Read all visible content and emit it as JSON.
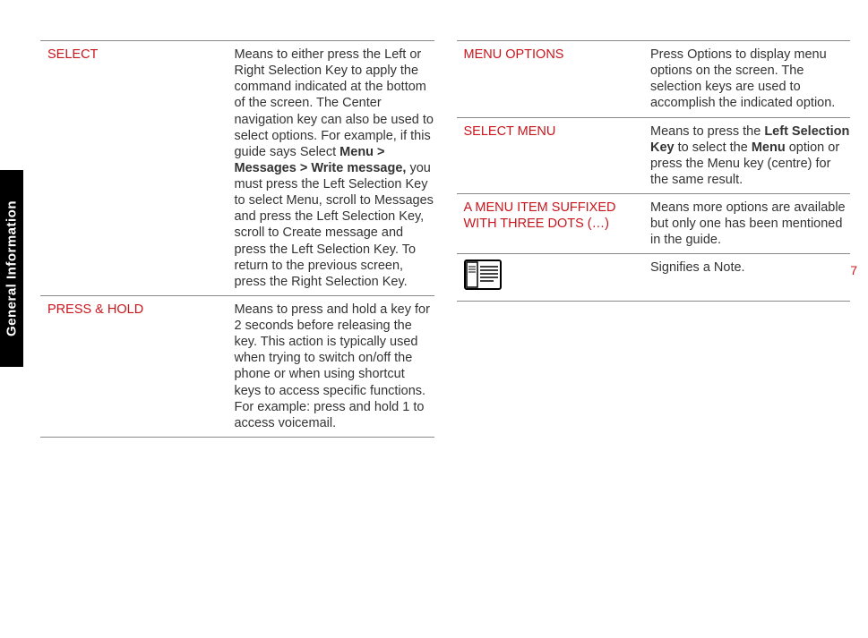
{
  "sideTab": {
    "label": "General Information"
  },
  "pageNumber": "7",
  "left": {
    "rows": [
      {
        "term": "SELECT",
        "desc_pre": "Means to either press the Left or Right Selection Key to apply the command indicated at the bottom of the screen. The Center navigation key can also be used to select options. For example, if this guide says Select ",
        "desc_bold": "Menu > Messages > Write message,",
        "desc_post": " you must press the Left Selection Key to select Menu, scroll to Messages and press the Left Selection Key, scroll to Create message and press the Left Selection Key. To return to the previous screen, press the Right Selection Key."
      },
      {
        "term": "PRESS & HOLD",
        "desc": "Means to press and hold a key for 2 seconds before releasing the key. This action is typically used when trying to switch on/off the phone or when using shortcut keys to access specific functions. For example: press and hold 1 to access voicemail."
      }
    ]
  },
  "right": {
    "rows": [
      {
        "term": "MENU OPTIONS",
        "desc": "Press Options to display menu options on the screen. The selection keys are used to accomplish the indicated option."
      },
      {
        "term": "SELECT MENU",
        "desc_pre": "Means to press the ",
        "desc_bold1": "Left Selection Key",
        "desc_mid": " to select the ",
        "desc_bold2": "Menu",
        "desc_post": " option or press the Menu key (centre) for the same result."
      },
      {
        "term": "A MENU ITEM SUFFIXED WITH THREE DOTS (…)",
        "desc": "Means more options are available but only one has been mentioned in the guide."
      },
      {
        "icon": true,
        "desc": "Signifies a Note."
      }
    ]
  }
}
